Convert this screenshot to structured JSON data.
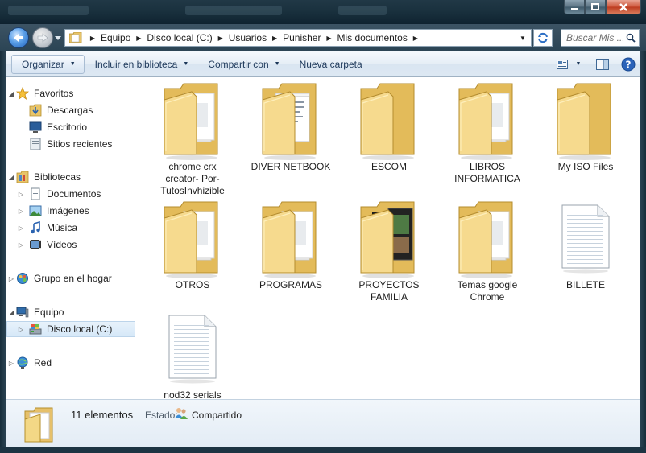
{
  "window": {
    "minimize_label": "minimize",
    "maximize_label": "maximize",
    "close_label": "close"
  },
  "address": {
    "crumbs": [
      "Equipo",
      "Disco local (C:)",
      "Usuarios",
      "Punisher",
      "Mis documentos"
    ]
  },
  "search": {
    "placeholder": "Buscar Mis ..."
  },
  "toolbar": {
    "organize": "Organizar",
    "include": "Incluir en biblioteca",
    "share": "Compartir con",
    "new_folder": "Nueva carpeta"
  },
  "sidebar": {
    "favorites": "Favoritos",
    "downloads": "Descargas",
    "desktop": "Escritorio",
    "recent": "Sitios recientes",
    "libraries": "Bibliotecas",
    "documents": "Documentos",
    "images": "Imágenes",
    "music": "Música",
    "videos": "Vídeos",
    "homegroup": "Grupo en el hogar",
    "computer": "Equipo",
    "local_disk": "Disco local (C:)",
    "network": "Red"
  },
  "items": [
    {
      "name": "chrome crx creator- Por-TutosInvhizible",
      "type": "folder",
      "icon": "folder-papers-icon"
    },
    {
      "name": "DIVER NETBOOK",
      "type": "folder",
      "icon": "folder-docs-icon"
    },
    {
      "name": "ESCOM",
      "type": "folder",
      "icon": "folder-empty-icon"
    },
    {
      "name": "LIBROS INFORMATICA",
      "type": "folder",
      "icon": "folder-papers-icon"
    },
    {
      "name": "My ISO Files",
      "type": "folder",
      "icon": "folder-empty-icon"
    },
    {
      "name": "OTROS",
      "type": "folder",
      "icon": "folder-papers-icon"
    },
    {
      "name": "PROGRAMAS",
      "type": "folder",
      "icon": "folder-papers-icon"
    },
    {
      "name": "PROYECTOS FAMILIA",
      "type": "folder",
      "icon": "folder-photos-icon"
    },
    {
      "name": "Temas google Chrome",
      "type": "folder",
      "icon": "folder-papers-icon"
    },
    {
      "name": "BILLETE",
      "type": "file",
      "icon": "text-document-icon"
    },
    {
      "name": "nod32 serials",
      "type": "file",
      "icon": "text-document-icon"
    }
  ],
  "details": {
    "count": "11 elementos",
    "state_label": "Estado:",
    "state_value": "Compartido"
  },
  "colors": {
    "folder_yellow": "#f2d47a",
    "toolbar_text": "#1e395b",
    "frame": "#1d3443"
  }
}
